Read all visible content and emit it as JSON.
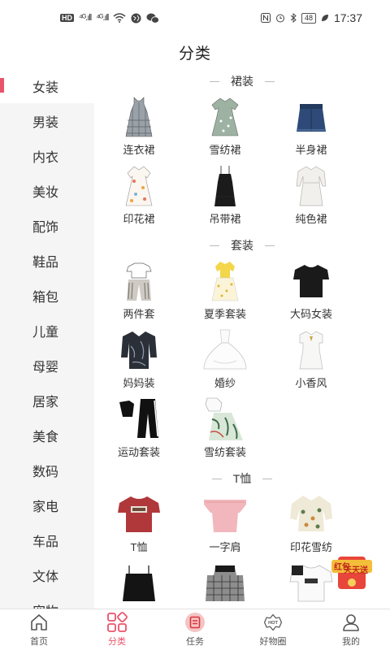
{
  "status_bar": {
    "hd": "HD",
    "sig1": "⁴ᴳ.ıll",
    "sig2": "⁴ᴳ.ıll",
    "battery": "48",
    "time": "17:37"
  },
  "header": {
    "title": "分类"
  },
  "sidebar": {
    "active_index": 0,
    "items": [
      {
        "label": "女装"
      },
      {
        "label": "男装"
      },
      {
        "label": "内衣"
      },
      {
        "label": "美妆"
      },
      {
        "label": "配饰"
      },
      {
        "label": "鞋品"
      },
      {
        "label": "箱包"
      },
      {
        "label": "儿童"
      },
      {
        "label": "母婴"
      },
      {
        "label": "居家"
      },
      {
        "label": "美食"
      },
      {
        "label": "数码"
      },
      {
        "label": "家电"
      },
      {
        "label": "车品"
      },
      {
        "label": "文体"
      },
      {
        "label": "宠物"
      }
    ]
  },
  "sections": [
    {
      "title": "裙装",
      "items": [
        {
          "label": "连衣裙",
          "icon": "plaid-dress-icon"
        },
        {
          "label": "雪纺裙",
          "icon": "floral-dress-icon"
        },
        {
          "label": "半身裙",
          "icon": "denim-skirt-icon"
        },
        {
          "label": "印花裙",
          "icon": "print-dress-icon"
        },
        {
          "label": "吊带裙",
          "icon": "slip-dress-icon"
        },
        {
          "label": "纯色裙",
          "icon": "white-dress-icon"
        }
      ]
    },
    {
      "title": "套装",
      "items": [
        {
          "label": "两件套",
          "icon": "two-piece-icon"
        },
        {
          "label": "夏季套装",
          "icon": "summer-set-icon"
        },
        {
          "label": "大码女装",
          "icon": "plus-size-tee-icon"
        },
        {
          "label": "妈妈装",
          "icon": "mom-blouse-icon"
        },
        {
          "label": "婚纱",
          "icon": "wedding-gown-icon"
        },
        {
          "label": "小香风",
          "icon": "white-mini-dress-icon"
        },
        {
          "label": "运动套装",
          "icon": "sportswear-icon"
        },
        {
          "label": "雪纺套装",
          "icon": "chiffon-set-icon"
        }
      ]
    },
    {
      "title": "T恤",
      "items": [
        {
          "label": "T恤",
          "icon": "red-tshirt-icon"
        },
        {
          "label": "一字肩",
          "icon": "off-shoulder-top-icon"
        },
        {
          "label": "印花雪纺",
          "icon": "print-chiffon-top-icon"
        },
        {
          "label": "",
          "icon": "black-camisole-icon"
        },
        {
          "label": "",
          "icon": "plaid-top-icon"
        },
        {
          "label": "",
          "icon": "white-tee-icon"
        }
      ]
    }
  ],
  "promo": {
    "line1": "红包",
    "line2": "天天送"
  },
  "tabbar": {
    "active_index": 1,
    "items": [
      {
        "label": "首页",
        "icon": "home-icon"
      },
      {
        "label": "分类",
        "icon": "category-icon"
      },
      {
        "label": "任务",
        "icon": "task-icon"
      },
      {
        "label": "好物圈",
        "icon": "hot-circle-icon"
      },
      {
        "label": "我的",
        "icon": "profile-icon"
      }
    ]
  }
}
